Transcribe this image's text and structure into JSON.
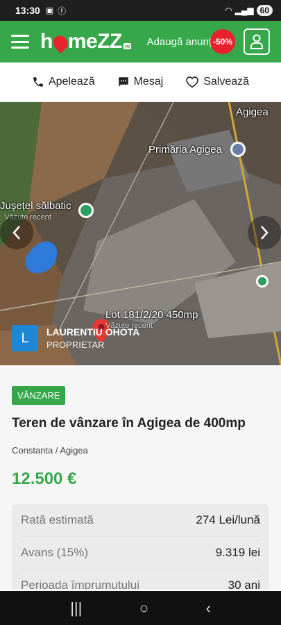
{
  "status": {
    "time": "13:30",
    "battery": "60"
  },
  "header": {
    "logo_left": "h",
    "logo_right": "meZZ",
    "logo_ro": "ro",
    "add_ad_label": "Adaugă anunț",
    "discount_badge": "-50%"
  },
  "actions": {
    "call_label": "Apelează",
    "message_label": "Mesaj",
    "save_label": "Salvează"
  },
  "gallery": {
    "labels": {
      "agigea": "Agigea",
      "primaria": "Primăria Agigea",
      "busetel": "Jușețel sălbatic",
      "busetel_sub": "Văzute recent",
      "lot": "Lot 181/2/20 450mp",
      "lot_sub": "Văzute recent"
    },
    "owner": {
      "initial": "L",
      "name": "LAURENTIU OHOTA",
      "role": "PROPRIETAR"
    }
  },
  "listing": {
    "tag": "VÂNZARE",
    "title": "Teren de vânzare în Agigea de 400mp",
    "location": "Constanta / Agigea",
    "price": "12.500 €"
  },
  "financing": [
    {
      "label": "Rată estimată",
      "value": "274 Lei/lună"
    },
    {
      "label": "Avans (15%)",
      "value": "9.319 lei"
    },
    {
      "label": "Perioada împrumutului",
      "value": "30 ani"
    }
  ],
  "colors": {
    "brand": "#36a84a",
    "accent_red": "#e8222c",
    "avatar_blue": "#1e88d6"
  }
}
